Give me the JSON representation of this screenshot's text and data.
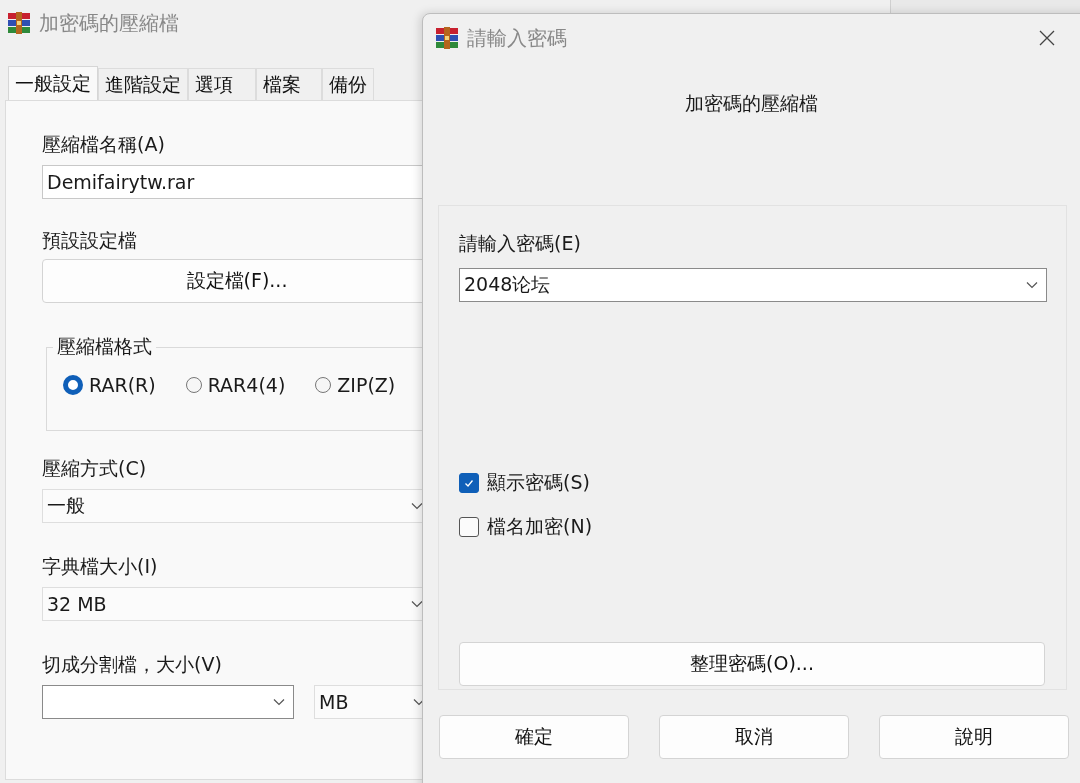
{
  "back_window": {
    "title": "加密碼的壓縮檔",
    "tabs": [
      {
        "label": "一般設定",
        "selected": true
      },
      {
        "label": "進階設定",
        "selected": false
      },
      {
        "label": "選項",
        "selected": false
      },
      {
        "label": "檔案",
        "selected": false
      },
      {
        "label": "備份",
        "selected": false
      }
    ],
    "archive_name": {
      "label": "壓縮檔名稱(A)",
      "value": "Demifairytw.rar"
    },
    "profiles": {
      "label": "預設設定檔",
      "button": "設定檔(F)..."
    },
    "format": {
      "legend": "壓縮檔格式",
      "options": [
        {
          "label": "RAR(R)",
          "selected": true
        },
        {
          "label": "RAR4(4)",
          "selected": false
        },
        {
          "label": "ZIP(Z)",
          "selected": false
        }
      ]
    },
    "method": {
      "label": "壓縮方式(C)",
      "value": "一般"
    },
    "dictionary": {
      "label": "字典檔大小(I)",
      "value": "32 MB"
    },
    "split": {
      "label": "切成分割檔，大小(V)",
      "unit": "MB"
    }
  },
  "dialog": {
    "title": "請輸入密碼",
    "archive_title": "加密碼的壓縮檔",
    "password": {
      "label": "請輸入密碼(E)",
      "value": "2048论坛"
    },
    "options": [
      {
        "label": "顯示密碼(S)",
        "checked": true
      },
      {
        "label": "檔名加密(N)",
        "checked": false
      }
    ],
    "organize_button": "整理密碼(O)...",
    "buttons": [
      "確定",
      "取消",
      "說明"
    ]
  }
}
